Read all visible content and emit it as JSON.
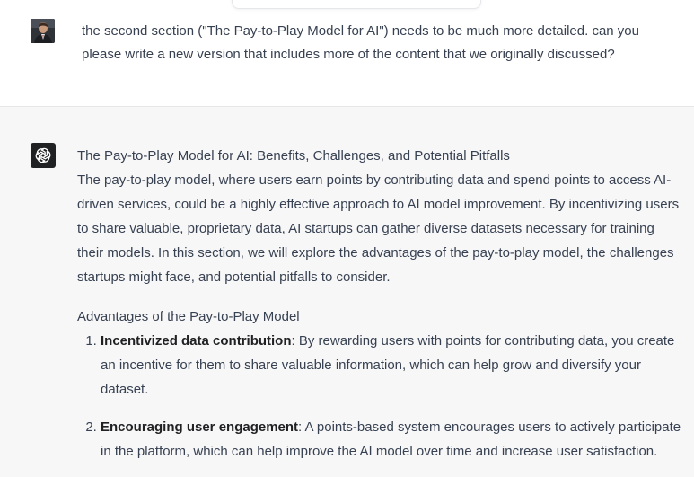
{
  "user_message": {
    "text": "the second section (\"The Pay-to-Play Model for AI\") needs to be much more detailed. can you please write a new version that includes more of the content that we originally discussed?"
  },
  "assistant_message": {
    "heading": "The Pay-to-Play Model for AI: Benefits, Challenges, and Potential Pitfalls",
    "intro": "The pay-to-play model, where users earn points by contributing data and spend points to access AI-driven services, could be a highly effective approach to AI model improvement. By incentivizing users to share valuable, proprietary data, AI startups can gather diverse datasets necessary for training their models. In this section, we will explore the advantages of the pay-to-play model, the challenges startups might face, and potential pitfalls to consider.",
    "subheading": "Advantages of the Pay-to-Play Model",
    "items": [
      {
        "title": "Incentivized data contribution",
        "body": ": By rewarding users with points for contributing data, you create an incentive for them to share valuable information, which can help grow and diversify your dataset."
      },
      {
        "title": "Encouraging user engagement",
        "body": ": A points-based system encourages users to actively participate in the platform, which can help improve the AI model over time and increase user satisfaction."
      }
    ]
  },
  "icons": {
    "user_avatar": "user-photo-avatar",
    "assistant_avatar": "openai-logo-icon"
  },
  "colors": {
    "assistant_avatar_bg": "#202123",
    "user_bg": "#ffffff",
    "assistant_bg": "#f7f7f8",
    "text": "#374151"
  }
}
